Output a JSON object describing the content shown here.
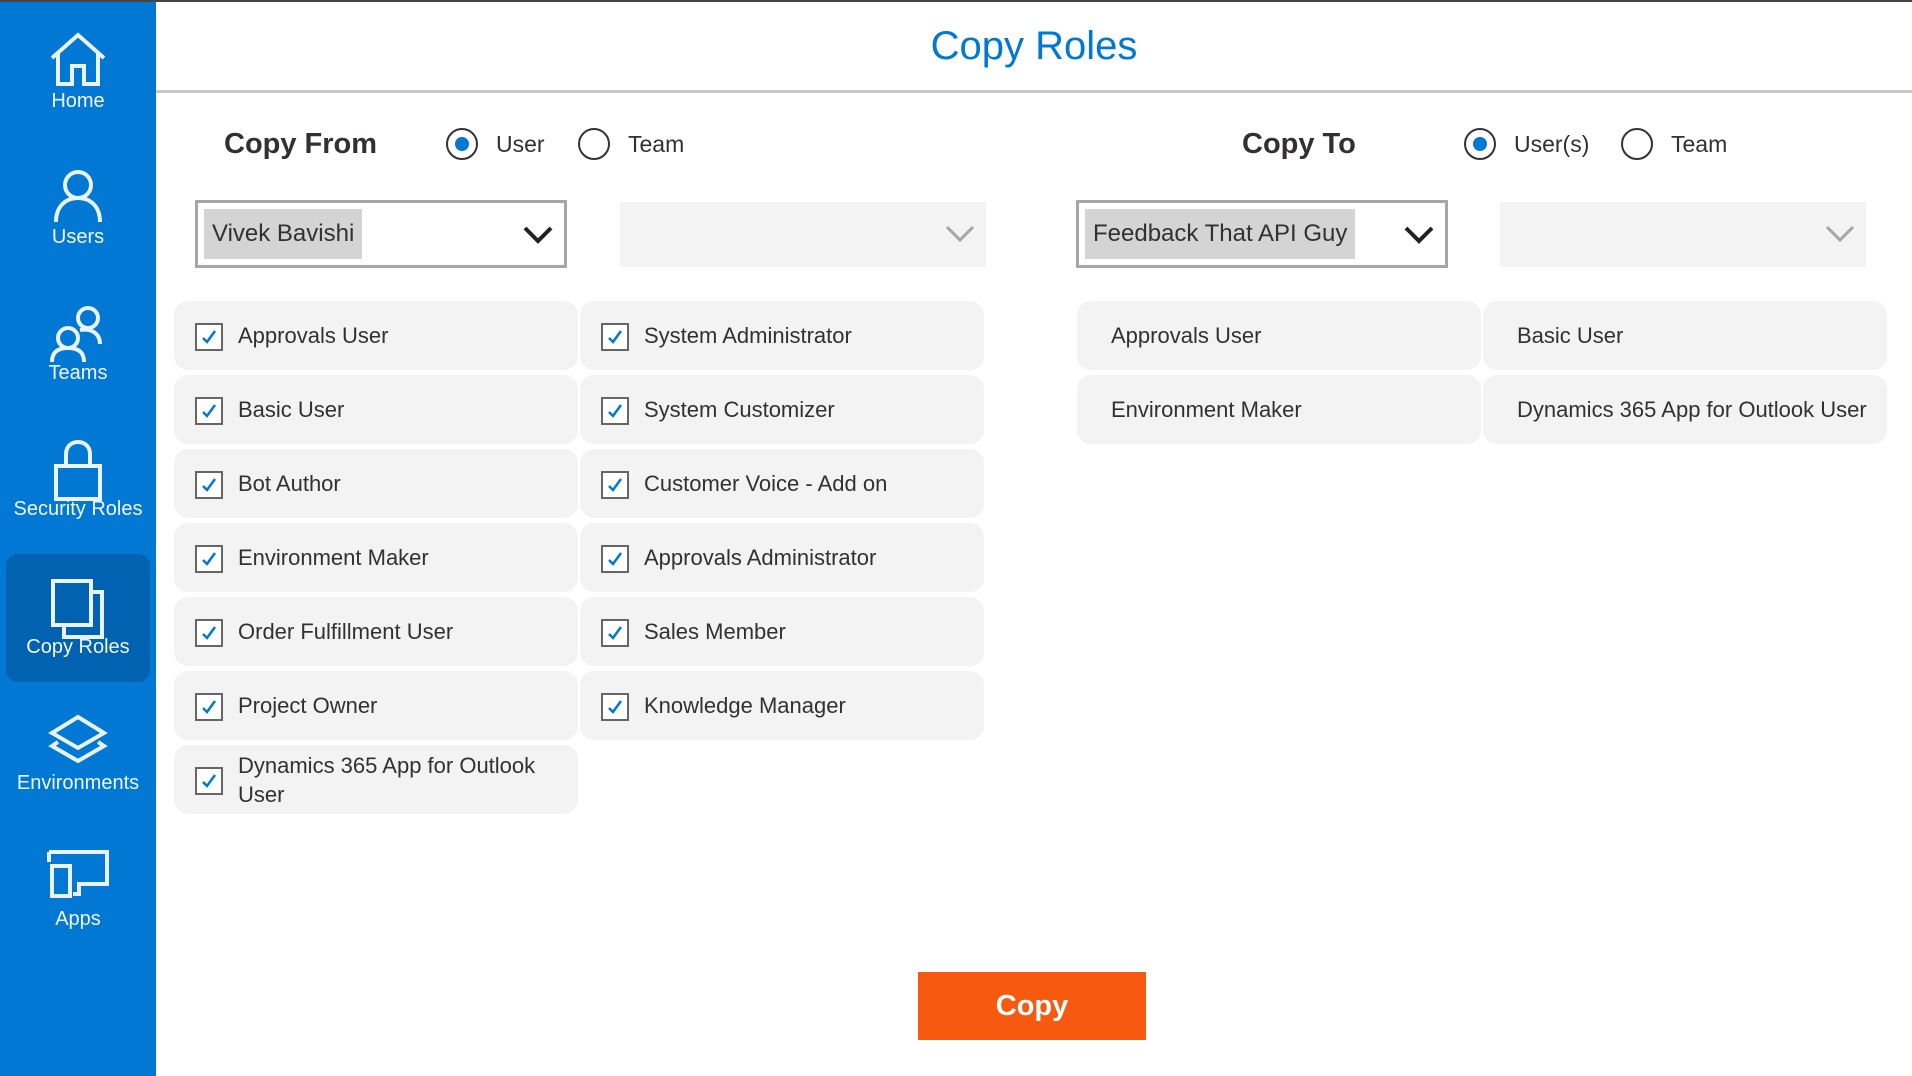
{
  "sidebar": {
    "items": [
      {
        "label": "Home",
        "icon": "home-icon",
        "active": false
      },
      {
        "label": "Users",
        "icon": "user-icon",
        "active": false
      },
      {
        "label": "Teams",
        "icon": "people-icon",
        "active": false
      },
      {
        "label": "Security Roles",
        "icon": "lock-icon",
        "active": false
      },
      {
        "label": "Copy Roles",
        "icon": "copy-icon",
        "active": true
      },
      {
        "label": "Environments",
        "icon": "layers-icon",
        "active": false
      },
      {
        "label": "Apps",
        "icon": "devices-icon",
        "active": false
      }
    ]
  },
  "header": {
    "title": "Copy Roles"
  },
  "copy_from": {
    "label": "Copy From",
    "radio_options": [
      {
        "label": "User",
        "selected": true
      },
      {
        "label": "Team",
        "selected": false
      }
    ],
    "user_dropdown": {
      "value": "Vivek Bavishi"
    },
    "team_dropdown": {
      "value": ""
    },
    "roles": [
      {
        "label": "Approvals User",
        "checked": true
      },
      {
        "label": "System Administrator",
        "checked": true
      },
      {
        "label": "Basic User",
        "checked": true
      },
      {
        "label": "System Customizer",
        "checked": true
      },
      {
        "label": "Bot Author",
        "checked": true
      },
      {
        "label": "Customer Voice - Add on",
        "checked": true
      },
      {
        "label": "Environment Maker",
        "checked": true
      },
      {
        "label": "Approvals Administrator",
        "checked": true
      },
      {
        "label": "Order Fulfillment User",
        "checked": true
      },
      {
        "label": "Sales Member",
        "checked": true
      },
      {
        "label": "Project Owner",
        "checked": true
      },
      {
        "label": "Knowledge Manager",
        "checked": true
      },
      {
        "label": "Dynamics 365 App for Outlook User",
        "checked": true
      }
    ]
  },
  "copy_to": {
    "label": "Copy To",
    "radio_options": [
      {
        "label": "User(s)",
        "selected": true
      },
      {
        "label": "Team",
        "selected": false
      }
    ],
    "user_dropdown": {
      "value": "Feedback That API Guy"
    },
    "team_dropdown": {
      "value": ""
    },
    "roles": [
      {
        "label": "Approvals User"
      },
      {
        "label": "Basic User"
      },
      {
        "label": "Environment Maker"
      },
      {
        "label": "Dynamics 365 App for Outlook User"
      }
    ]
  },
  "actions": {
    "copy_label": "Copy"
  },
  "colors": {
    "brand": "#0078d4",
    "sidebar_active": "#0062b1",
    "copy_button": "#f7590f"
  }
}
